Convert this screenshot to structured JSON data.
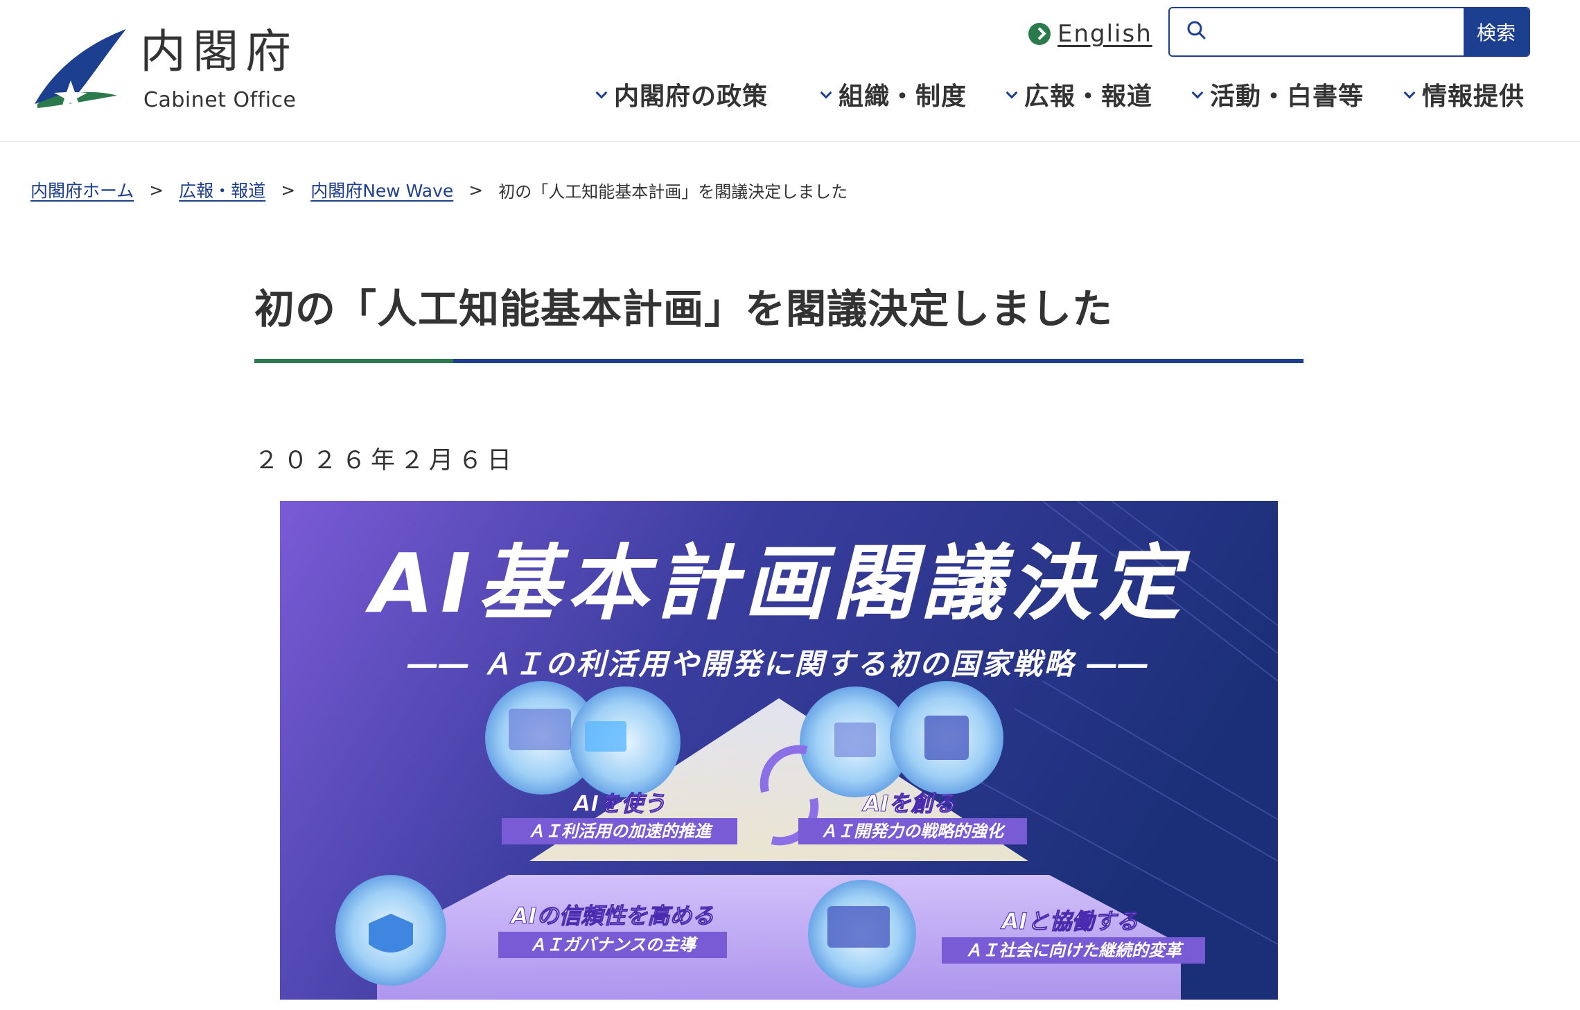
{
  "header": {
    "logo_jp": "内閣府",
    "logo_en": "Cabinet Office",
    "language_link": "English",
    "search": {
      "placeholder": "",
      "button_label": "検索"
    },
    "nav": [
      {
        "label": "内閣府の政策"
      },
      {
        "label": "組織・制度"
      },
      {
        "label": "広報・報道"
      },
      {
        "label": "活動・白書等"
      },
      {
        "label": "情報提供"
      }
    ]
  },
  "breadcrumb": {
    "items": [
      {
        "label": "内閣府ホーム"
      },
      {
        "label": "広報・報道"
      },
      {
        "label": "内閣府New Wave"
      }
    ],
    "separator": ">",
    "current": "初の「人工知能基本計画」を閣議決定しました"
  },
  "article": {
    "title": "初の「人工知能基本計画」を閣議決定しました",
    "date": "２０２６年２月６日"
  },
  "banner": {
    "headline": "AI基本計画閣議決定",
    "subtitle": "―― ＡＩの利活用や開発に関する初の国家戦略 ――",
    "pillars": [
      {
        "title": "AIを使う",
        "caption": "ＡＩ利活用の加速的推進"
      },
      {
        "title": "AIを創る",
        "caption": "ＡＩ開発力の戦略的強化"
      },
      {
        "title": "AIの信頼性を高める",
        "caption": "ＡＩガバナンスの主導"
      },
      {
        "title": "AIと協働する",
        "caption": "ＡＩ社会に向けた継続的変革"
      }
    ],
    "colors": {
      "deep_blue": "#1b2f78",
      "purple": "#7a5bd6",
      "lavender": "#b49af2"
    }
  },
  "colors": {
    "accent_blue": "#1d3f8f",
    "accent_green": "#2b7a4b"
  }
}
